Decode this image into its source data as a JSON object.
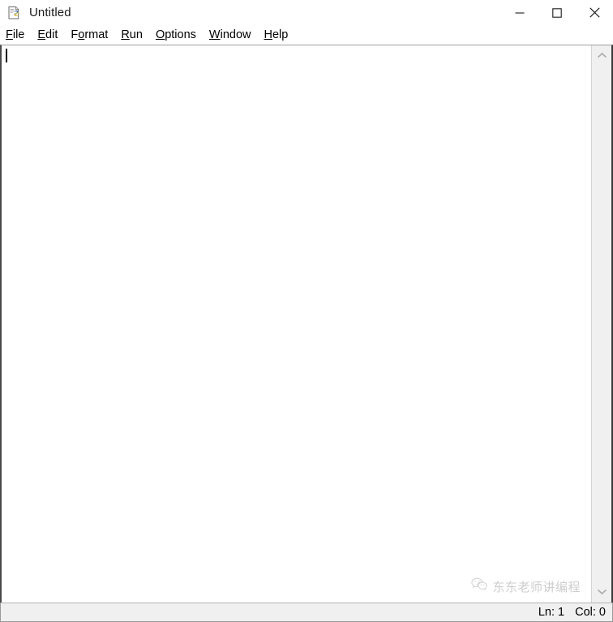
{
  "window": {
    "title": "Untitled",
    "icon": "python-idle-file-icon",
    "controls": {
      "minimize_label": "Minimize",
      "minimize_icon": "minimize-icon",
      "maximize_label": "Maximize",
      "maximize_icon": "maximize-icon",
      "close_label": "Close",
      "close_icon": "close-icon"
    }
  },
  "menubar": {
    "items": [
      {
        "label": "File",
        "mnemonic_index": 0
      },
      {
        "label": "Edit",
        "mnemonic_index": 0
      },
      {
        "label": "Format",
        "mnemonic_index": 1
      },
      {
        "label": "Run",
        "mnemonic_index": 0
      },
      {
        "label": "Options",
        "mnemonic_index": 0
      },
      {
        "label": "Window",
        "mnemonic_index": 0
      },
      {
        "label": "Help",
        "mnemonic_index": 0
      }
    ]
  },
  "editor": {
    "content": "",
    "caret_visible": true
  },
  "scrollbar": {
    "up_icon": "chevron-up-icon",
    "down_icon": "chevron-down-icon"
  },
  "watermark": {
    "icon": "wechat-icon",
    "text": "东东老师讲编程"
  },
  "statusbar": {
    "line_label": "Ln: 1",
    "col_label": "Col: 0"
  },
  "colors": {
    "window_bg": "#ffffff",
    "chrome_bg": "#f0f0f0",
    "border": "#9a9a9a",
    "text": "#000000",
    "watermark": "#c9c9c9"
  }
}
